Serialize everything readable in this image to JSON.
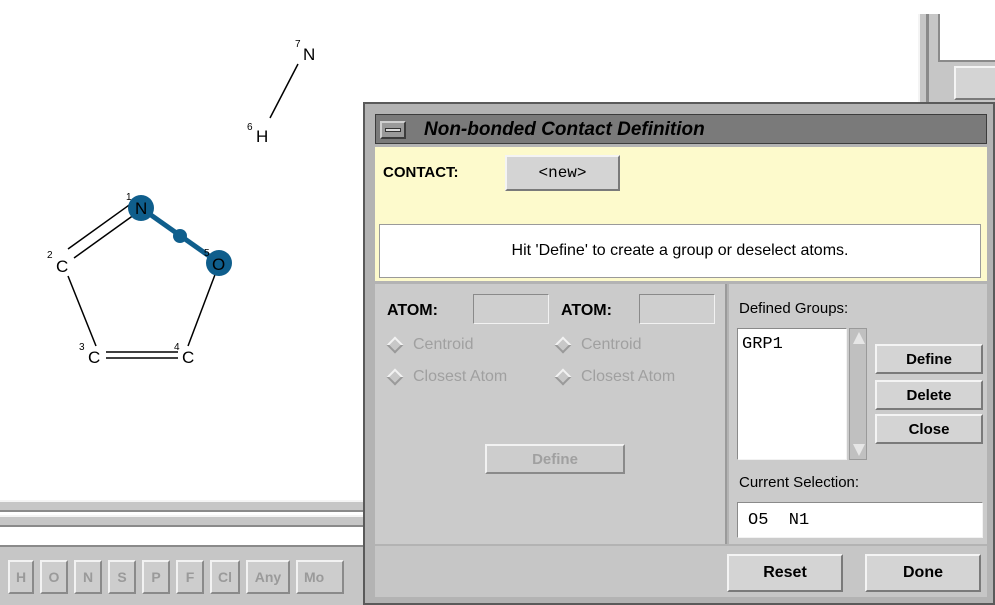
{
  "molecule": {
    "atoms": [
      {
        "element": "N",
        "index": "7"
      },
      {
        "element": "H",
        "index": "6"
      },
      {
        "element": "N",
        "index": "1"
      },
      {
        "element": "O",
        "index": "5"
      },
      {
        "element": "C",
        "index": "2"
      },
      {
        "element": "C",
        "index": "3"
      },
      {
        "element": "C",
        "index": "4"
      }
    ],
    "selection_color": "#0f5e8c"
  },
  "element_bar": {
    "buttons": [
      "H",
      "O",
      "N",
      "S",
      "P",
      "F",
      "Cl",
      "Any",
      "Mo"
    ]
  },
  "dialog": {
    "title": "Non-bonded Contact Definition",
    "contact": {
      "label": "CONTACT:",
      "value": "<new>"
    },
    "message": "Hit 'Define' to create a group or deselect atoms.",
    "left_panel": {
      "atom1_label": "ATOM:",
      "atom2_label": "ATOM:",
      "centroid_label": "Centroid",
      "closest_label": "Closest Atom",
      "define_label": "Define"
    },
    "right_panel": {
      "groups_label": "Defined Groups:",
      "groups": [
        "GRP1"
      ],
      "define_label": "Define",
      "delete_label": "Delete",
      "close_label": "Close",
      "selection_label": "Current Selection:",
      "selection_value": "O5  N1"
    },
    "footer": {
      "reset_label": "Reset",
      "done_label": "Done"
    }
  },
  "colors": {
    "dialog_header_bg": "#fdfacc",
    "panel_bg": "#cbcbcb",
    "title_bg": "#7a7a7a"
  }
}
